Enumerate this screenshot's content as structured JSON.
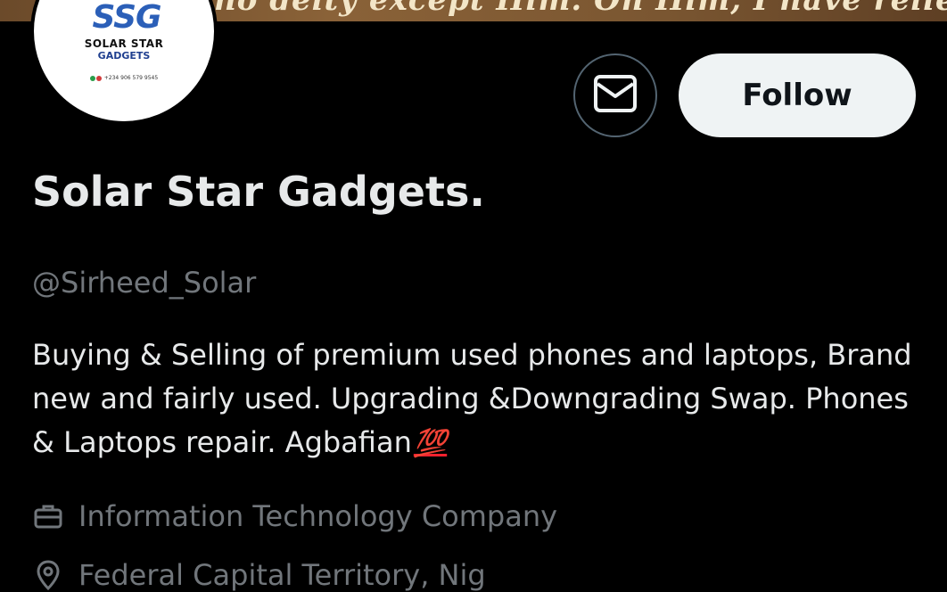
{
  "banner": {
    "text": "no deity except Him. On Him, I have relied."
  },
  "avatar": {
    "mark": "SSG",
    "line1": "SOLAR STAR",
    "line2": "GADGETS",
    "phone": "+234 906 579 9545"
  },
  "actions": {
    "message_icon": "envelope-icon",
    "follow_label": "Follow"
  },
  "profile": {
    "display_name": "Solar Star Gadgets.",
    "handle": "@Sirheed_Solar",
    "bio_text": "Buying & Selling of premium used phones and laptops, Brand new and fairly used. Upgrading &Downgrading Swap. Phones & Laptops repair. Agbafian",
    "bio_emoji": "💯",
    "category": "Information Technology Company",
    "location": "Federal Capital Territory, Nig"
  },
  "colors": {
    "background": "#000000",
    "primary_text": "#e7e9ea",
    "secondary_text": "#71767b",
    "follow_bg": "#eff3f4"
  }
}
